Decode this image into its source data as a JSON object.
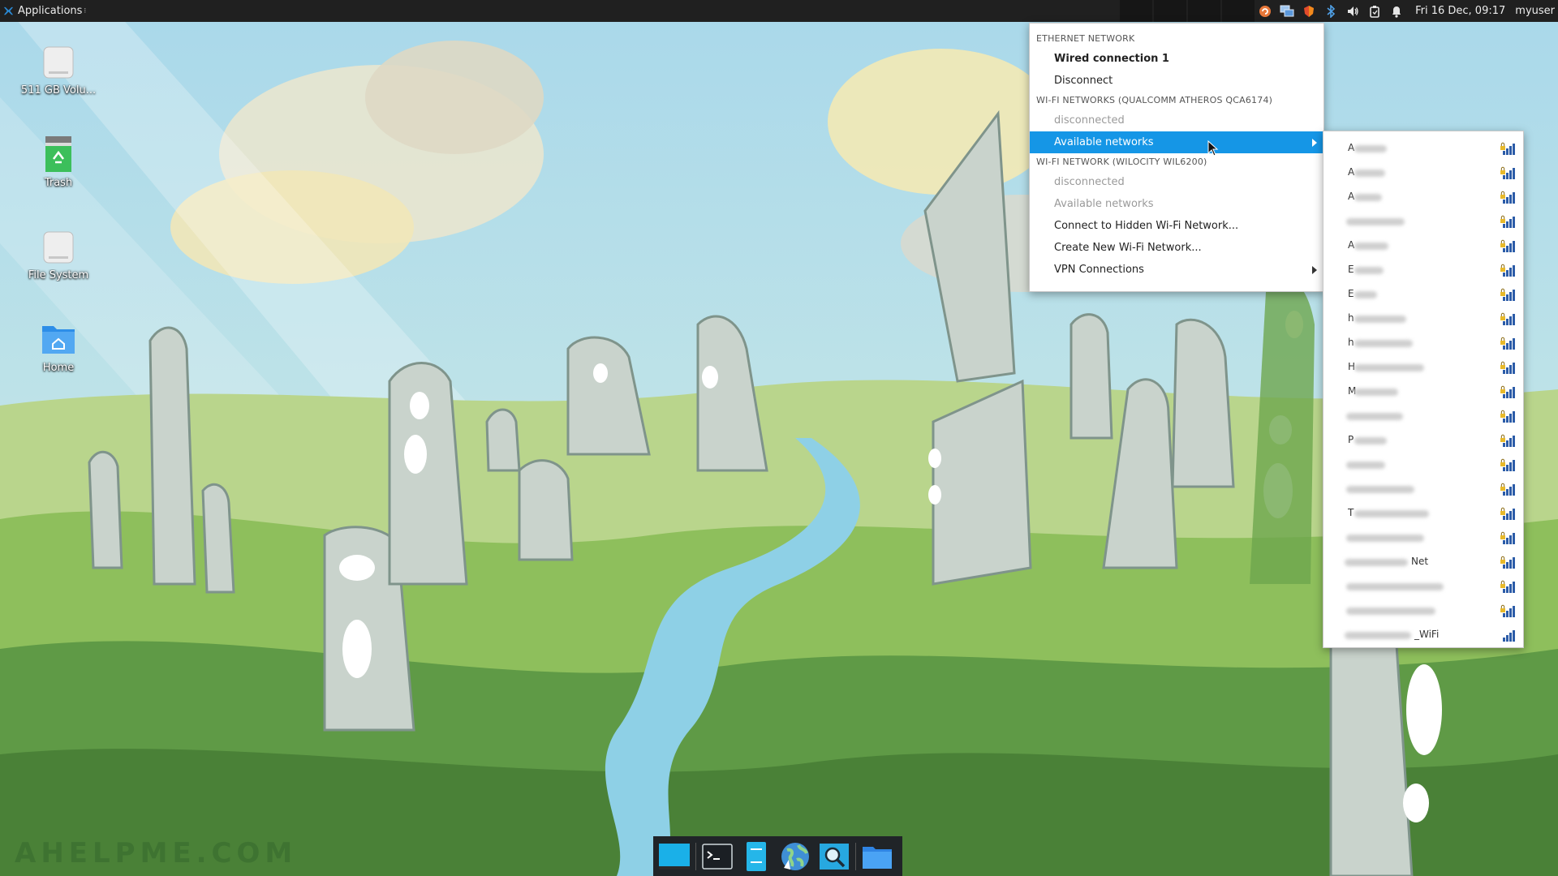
{
  "top_panel": {
    "applications_label": "Applications",
    "clock": "Fri 16 Dec, 09:17",
    "username": "myuser",
    "tray_icons": [
      "update-icon",
      "network-icon",
      "shield-icon",
      "bluetooth-icon",
      "volume-icon",
      "clipboard-icon",
      "notification-bell-icon"
    ]
  },
  "desktop": {
    "icons": [
      {
        "label": "511 GB Volu...",
        "icon": "drive-icon"
      },
      {
        "label": "Trash",
        "icon": "trash-icon"
      },
      {
        "label": "File System",
        "icon": "drive-icon"
      },
      {
        "label": "Home",
        "icon": "home-folder-icon"
      }
    ]
  },
  "network_menu": {
    "ethernet_header": "Ethernet Network",
    "wired_connection": "Wired connection 1",
    "disconnect": "Disconnect",
    "wifi1_header": "Wi-Fi Networks (Qualcomm Atheros QCA6174)",
    "wifi1_status": "disconnected",
    "wifi1_available": "Available networks",
    "wifi2_header": "Wi-Fi Network (Wilocity Wil6200)",
    "wifi2_status": "disconnected",
    "wifi2_available": "Available networks",
    "connect_hidden": "Connect to Hidden Wi-Fi Network...",
    "create_new": "Create New Wi-Fi Network...",
    "vpn": "VPN Connections"
  },
  "available_networks": [
    {
      "visible_text": "A"
    },
    {
      "visible_text": "A"
    },
    {
      "visible_text": "A"
    },
    {
      "visible_text": ""
    },
    {
      "visible_text": "A"
    },
    {
      "visible_text": "E"
    },
    {
      "visible_text": "E"
    },
    {
      "visible_text": "h"
    },
    {
      "visible_text": "h"
    },
    {
      "visible_text": "H"
    },
    {
      "visible_text": "M"
    },
    {
      "visible_text": ""
    },
    {
      "visible_text": "P"
    },
    {
      "visible_text": ""
    },
    {
      "visible_text": ""
    },
    {
      "visible_text": "T"
    },
    {
      "visible_text": ""
    },
    {
      "visible_text": "Net"
    },
    {
      "visible_text": ""
    },
    {
      "visible_text": ""
    },
    {
      "visible_text": "_WiFi"
    }
  ],
  "dock": {
    "items": [
      "show-desktop-icon",
      "terminal-icon",
      "file-manager-icon",
      "web-browser-icon",
      "app-finder-icon",
      "folder-icon"
    ]
  },
  "watermark": "AHELPME.COM",
  "colors": {
    "panel": "#202020",
    "menu_highlight": "#1596e6",
    "menu_bg": "#ffffff",
    "disabled_text": "#9a9a9a"
  }
}
